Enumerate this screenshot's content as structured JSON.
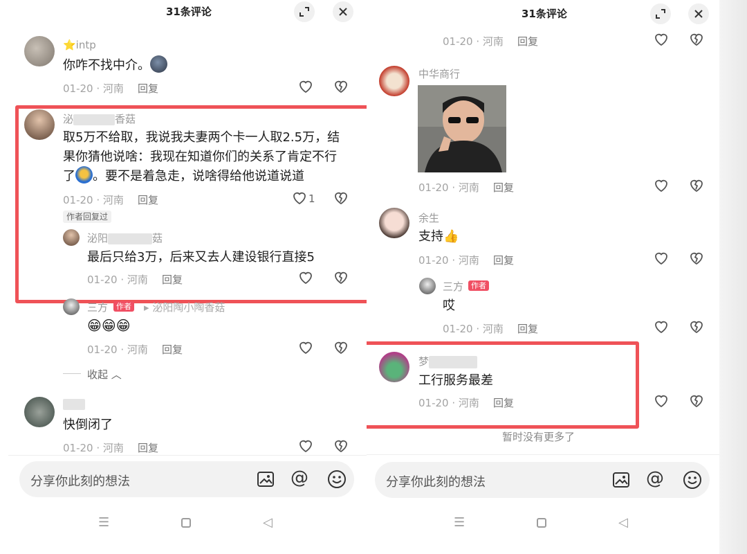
{
  "left": {
    "title": "31条评论",
    "comments": [
      {
        "name": "⭐intp",
        "text": "你咋不找中介。",
        "meta": "01-20 · 河南",
        "reply": "回复"
      },
      {
        "name_start": "泌",
        "name_end": "香菇",
        "text_lines": [
          "取5万不给取，我说我夫妻两个卡一人取2.5万，结",
          "果你猜他说啥：我现在知道你们的关系了肯定不行",
          "。要不是着急走，说啥得给他说道说道"
        ],
        "text_line3_prefix": "了",
        "meta": "01-20 · 河南",
        "reply": "回复",
        "likes": "1",
        "author_replied": "作者回复过"
      },
      {
        "sub": true,
        "name_start": "泌阳",
        "name_end": "菇",
        "text": "最后只给3万，后来又去人建设银行直接5",
        "meta": "01-20 · 河南",
        "reply": "回复"
      },
      {
        "sub": true,
        "name": "三方",
        "author_badge": "作者",
        "reply_to": "泌阳陶小陶香菇",
        "emoji": "😁😁😁",
        "meta": "01-20 · 河南",
        "reply": "回复"
      },
      {
        "collapse": "收起"
      },
      {
        "name": "",
        "text": "快倒闭了",
        "meta": "01-20 · 河南",
        "reply": "回复"
      }
    ],
    "input_placeholder": "分享你此刻的想法"
  },
  "right": {
    "title": "31条评论",
    "comments": [
      {
        "meta": "01-20 · 河南",
        "reply": "回复"
      },
      {
        "name": "中华商行",
        "meta": "01-20 · 河南",
        "reply": "回复"
      },
      {
        "name": "余生",
        "text": "支持👍",
        "meta": "01-20 · 河南",
        "reply": "回复"
      },
      {
        "sub": true,
        "name": "三方",
        "author_badge": "作者",
        "text": "哎",
        "meta": "01-20 · 河南",
        "reply": "回复"
      },
      {
        "name": "梦",
        "text": "工行服务最差",
        "meta": "01-20 · 河南",
        "reply": "回复"
      }
    ],
    "no_more": "暂时没有更多了",
    "input_placeholder": "分享你此刻的想法"
  },
  "icons": [
    "expand-icon",
    "close-icon",
    "heart-icon",
    "broken-heart-icon",
    "image-icon",
    "at-icon",
    "smile-icon",
    "menu-icon",
    "home-icon",
    "back-icon"
  ],
  "colors": {
    "highlight_box": "#ef5257",
    "author_badge": "#f04f63",
    "input_bg": "#f2f2f2"
  }
}
